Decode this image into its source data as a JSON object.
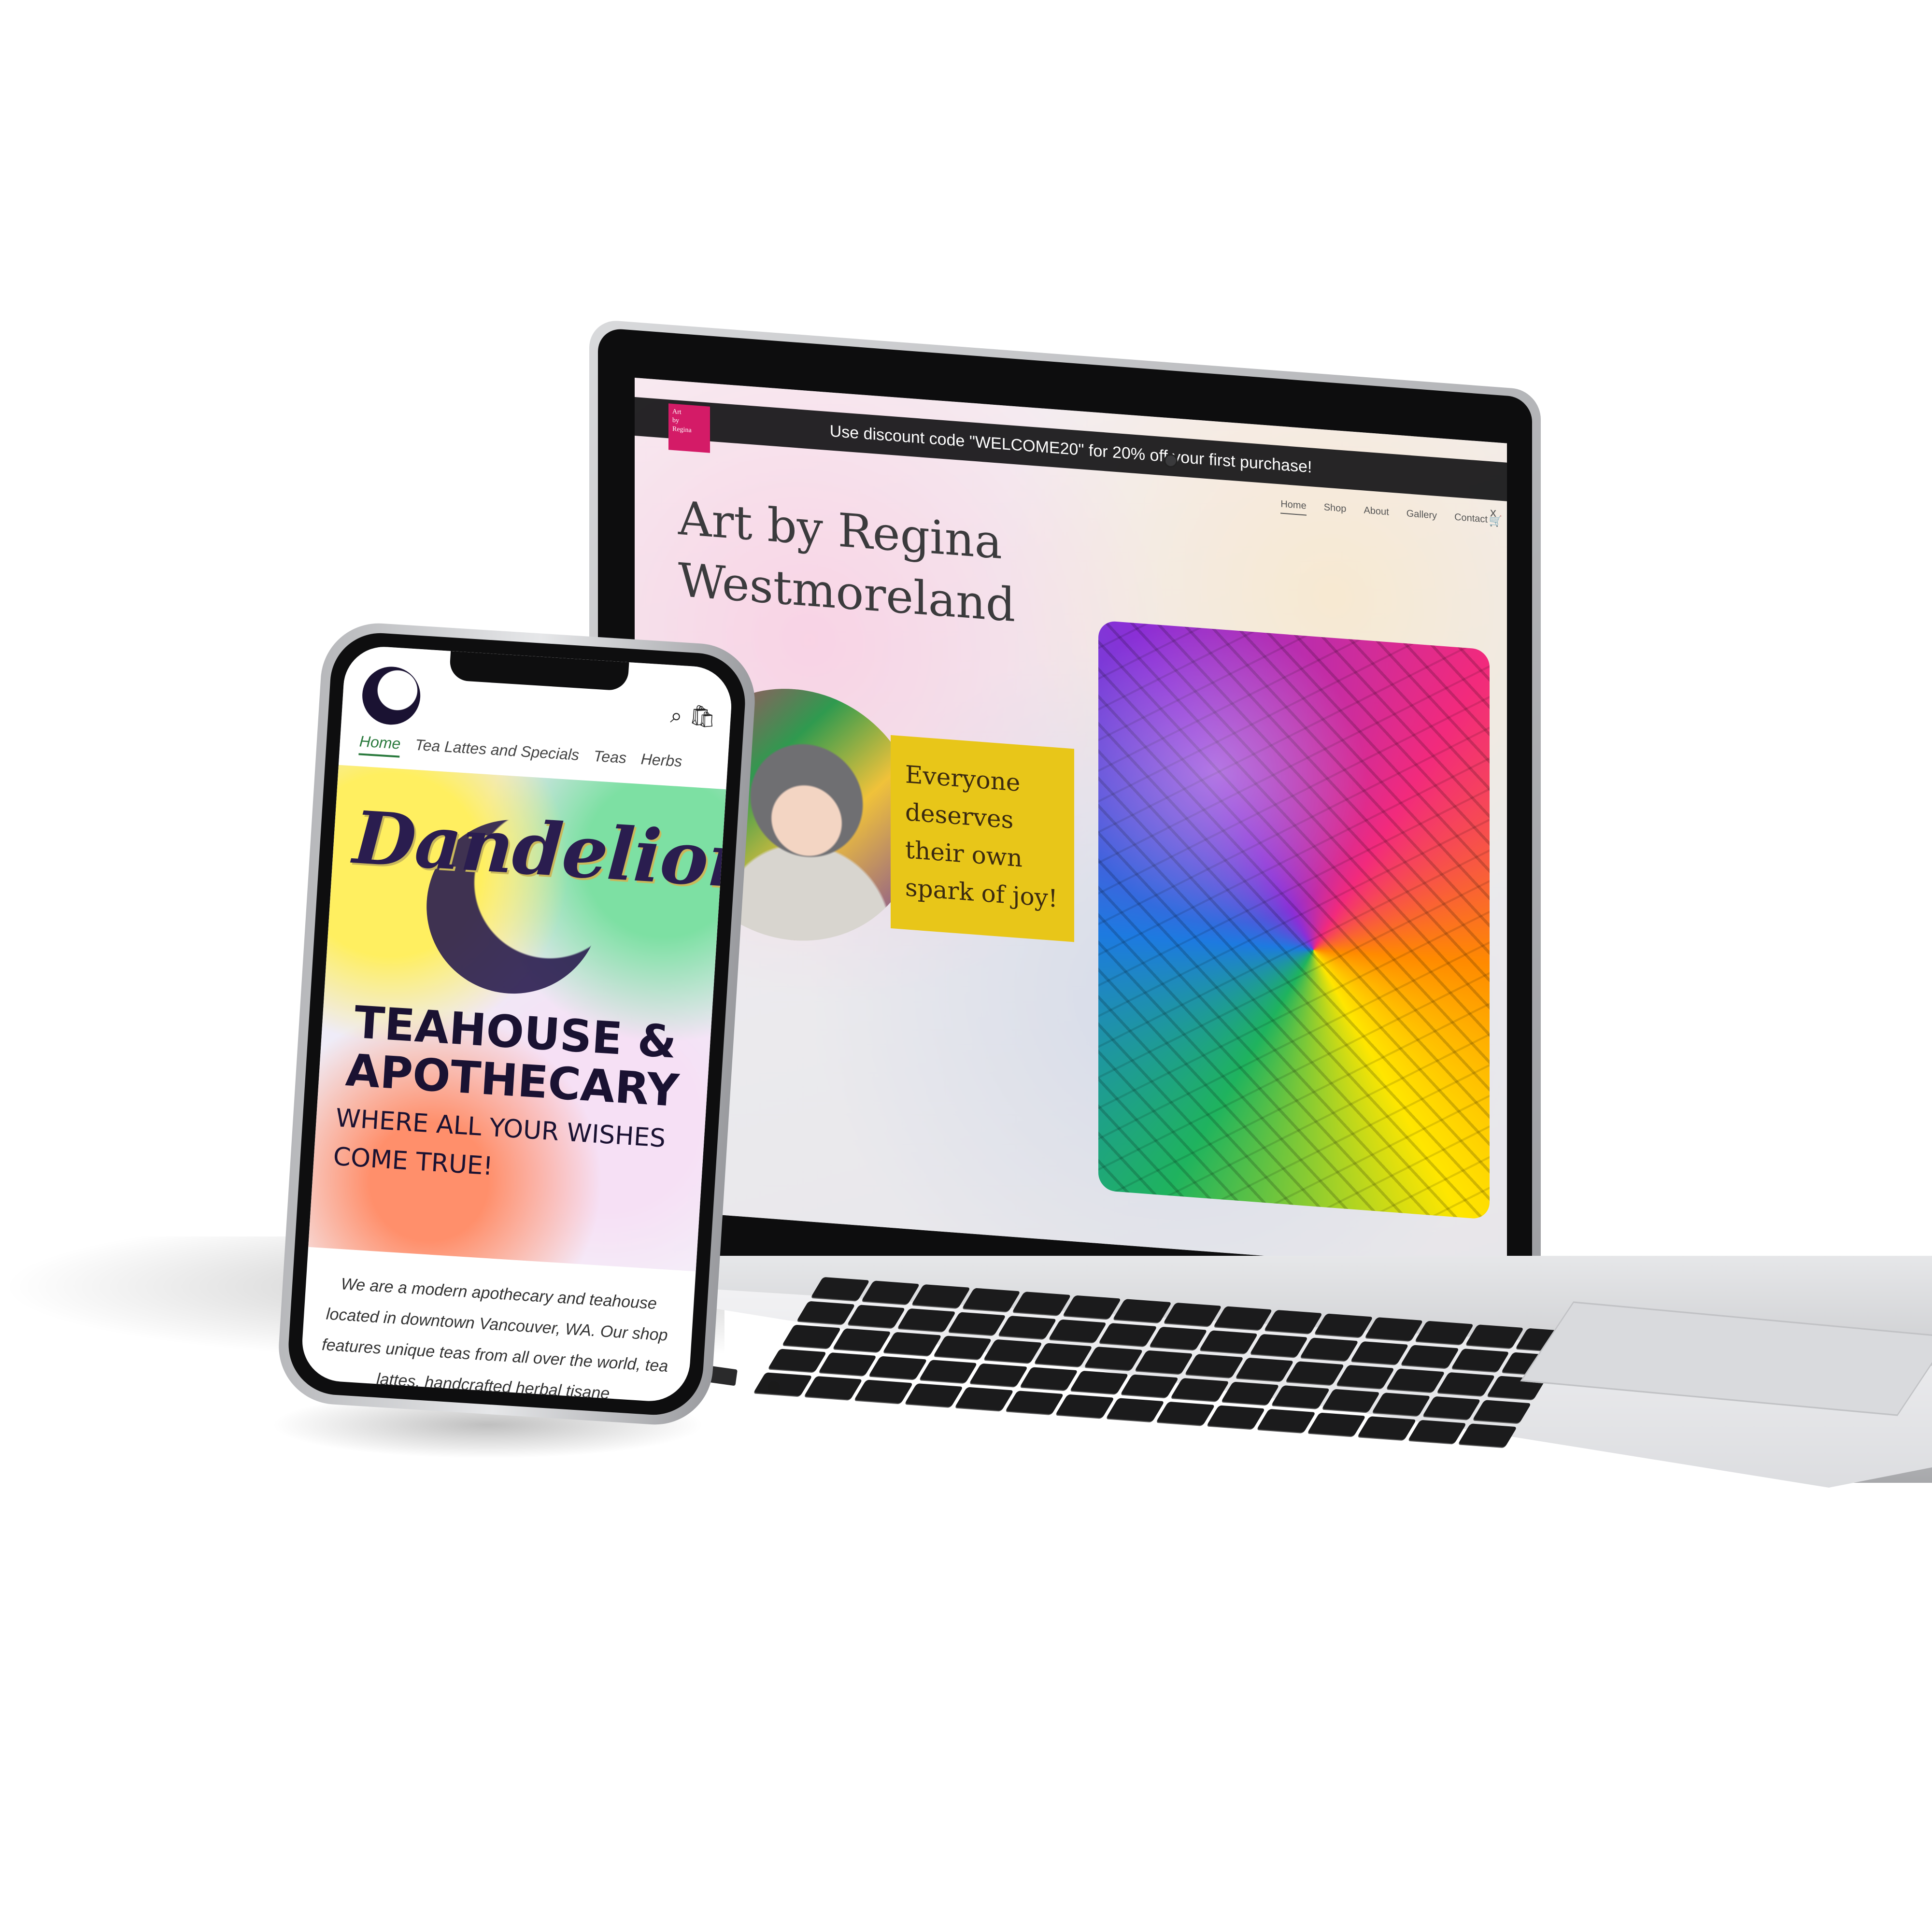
{
  "laptop_site": {
    "banner": "Use discount code \"WELCOME20\" for 20% off your first purchase!",
    "banner_close": "x",
    "logo_text": "Art\nby\nRegina",
    "nav": [
      "Home",
      "Shop",
      "About",
      "Gallery",
      "Contact"
    ],
    "cart_icon": "cart-icon",
    "title": "Art by Regina Westmoreland",
    "quote": "Everyone deserves their own spark of joy!"
  },
  "phone_site": {
    "search_icon": "search-icon",
    "bag_icon": "shopping-bag-icon",
    "nav": [
      "Home",
      "Tea Lattes and Specials",
      "Teas",
      "Herbs"
    ],
    "brand": "Dandelion",
    "heading": "TEAHOUSE & APOTHECARY",
    "tagline": "WHERE ALL YOUR WISHES COME TRUE!",
    "body": "We are a modern apothecary and teahouse located in downtown Vancouver, WA. Our shop features unique teas from all over the world, tea lattes, handcrafted herbal tisane"
  },
  "colors": {
    "quote_bg": "#e8c619",
    "logo_bg": "#d41b67",
    "nav_active": "#2a7a3d",
    "brand_ink": "#2a1d4f"
  }
}
